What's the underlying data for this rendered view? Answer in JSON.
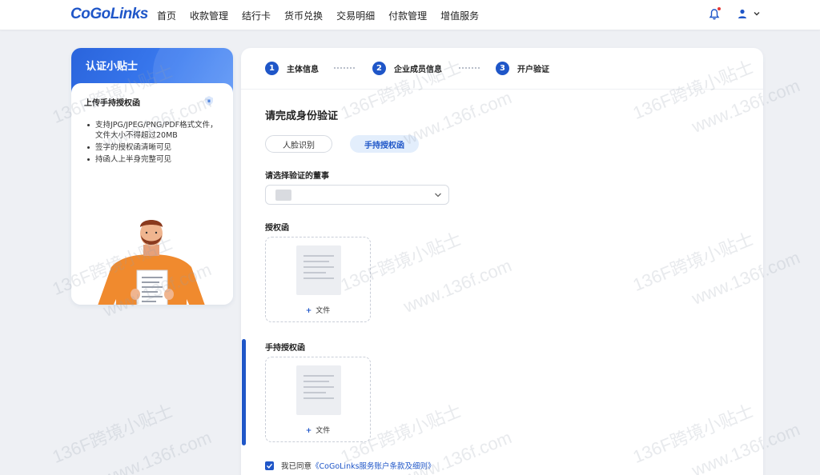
{
  "brand": {
    "logo_text": "CoGoLinks",
    "accent_color": "#1f56c8"
  },
  "nav": {
    "items": [
      "首页",
      "收款管理",
      "结行卡",
      "货币兑换",
      "交易明细",
      "付款管理",
      "增值服务"
    ]
  },
  "header_icons": {
    "notification": "bell-icon",
    "user": "user-icon",
    "dropdown": "chevron-down-icon"
  },
  "tips": {
    "title": "认证小贴士",
    "subtitle": "上传手持授权函",
    "items": [
      "支持JPG/JPEG/PNG/PDF格式文件， 文件大小不得超过20MB",
      "签字的授权函清晰可见",
      "持函人上半身完整可见"
    ]
  },
  "steps": [
    {
      "number": "1",
      "label": "主体信息"
    },
    {
      "number": "2",
      "label": "企业成员信息"
    },
    {
      "number": "3",
      "label": "开户验证"
    }
  ],
  "verify": {
    "title": "请完成身份验证",
    "methods": {
      "face": "人脸识别",
      "hand": "手持授权函"
    },
    "director_label": "请选择验证的董事",
    "auth_letter_label": "授权函",
    "hand_letter_label": "手持授权函",
    "upload_action": "文件",
    "agree_prefix": "我已同意",
    "agree_link": "《CoGoLinks服务账户条款及细则》"
  },
  "watermark": {
    "text": "136F跨境小贴士",
    "url": "www.136f.com"
  }
}
